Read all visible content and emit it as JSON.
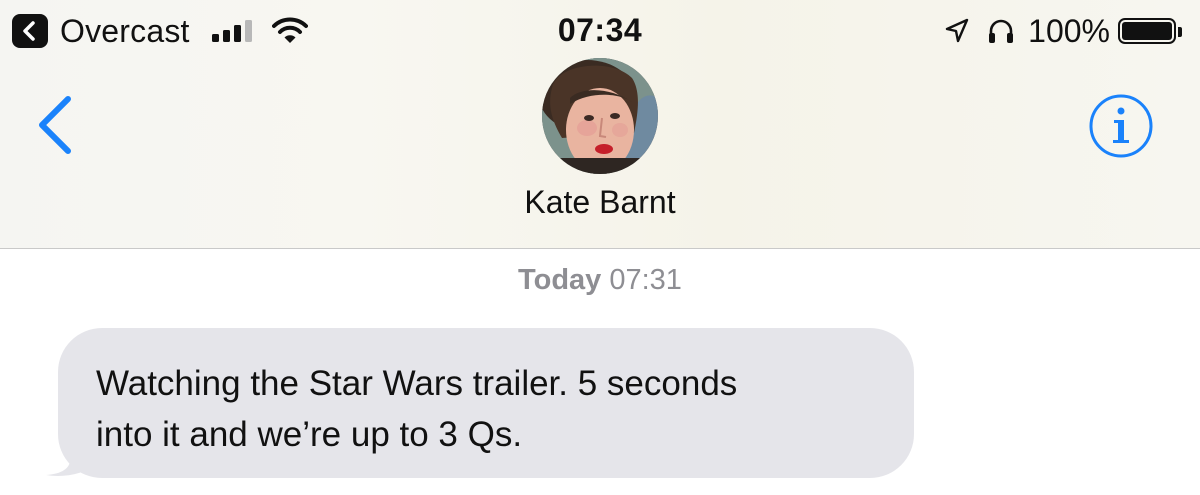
{
  "status_bar": {
    "back_app_label": "Overcast",
    "time": "07:34",
    "battery_percent": "100%",
    "battery_level": 1.0,
    "signal_bars": 3,
    "signal_bars_total": 4,
    "icons": [
      "back-to-app-icon",
      "cellular-signal-icon",
      "wifi-icon",
      "location-arrow-icon",
      "headphones-icon",
      "battery-icon"
    ]
  },
  "nav": {
    "back_icon": "chevron-left-icon",
    "info_icon": "info-icon",
    "contact_name": "Kate Barnt",
    "accent_color": "#1a82fb"
  },
  "conversation": {
    "timestamp_day": "Today",
    "timestamp_time": "07:31",
    "messages": [
      {
        "direction": "incoming",
        "lines": [
          "Watching the Star Wars trailer. 5 seconds",
          "into it and we’re up to 3 Qs."
        ],
        "bubble_color": "#e5e5ea"
      }
    ]
  }
}
